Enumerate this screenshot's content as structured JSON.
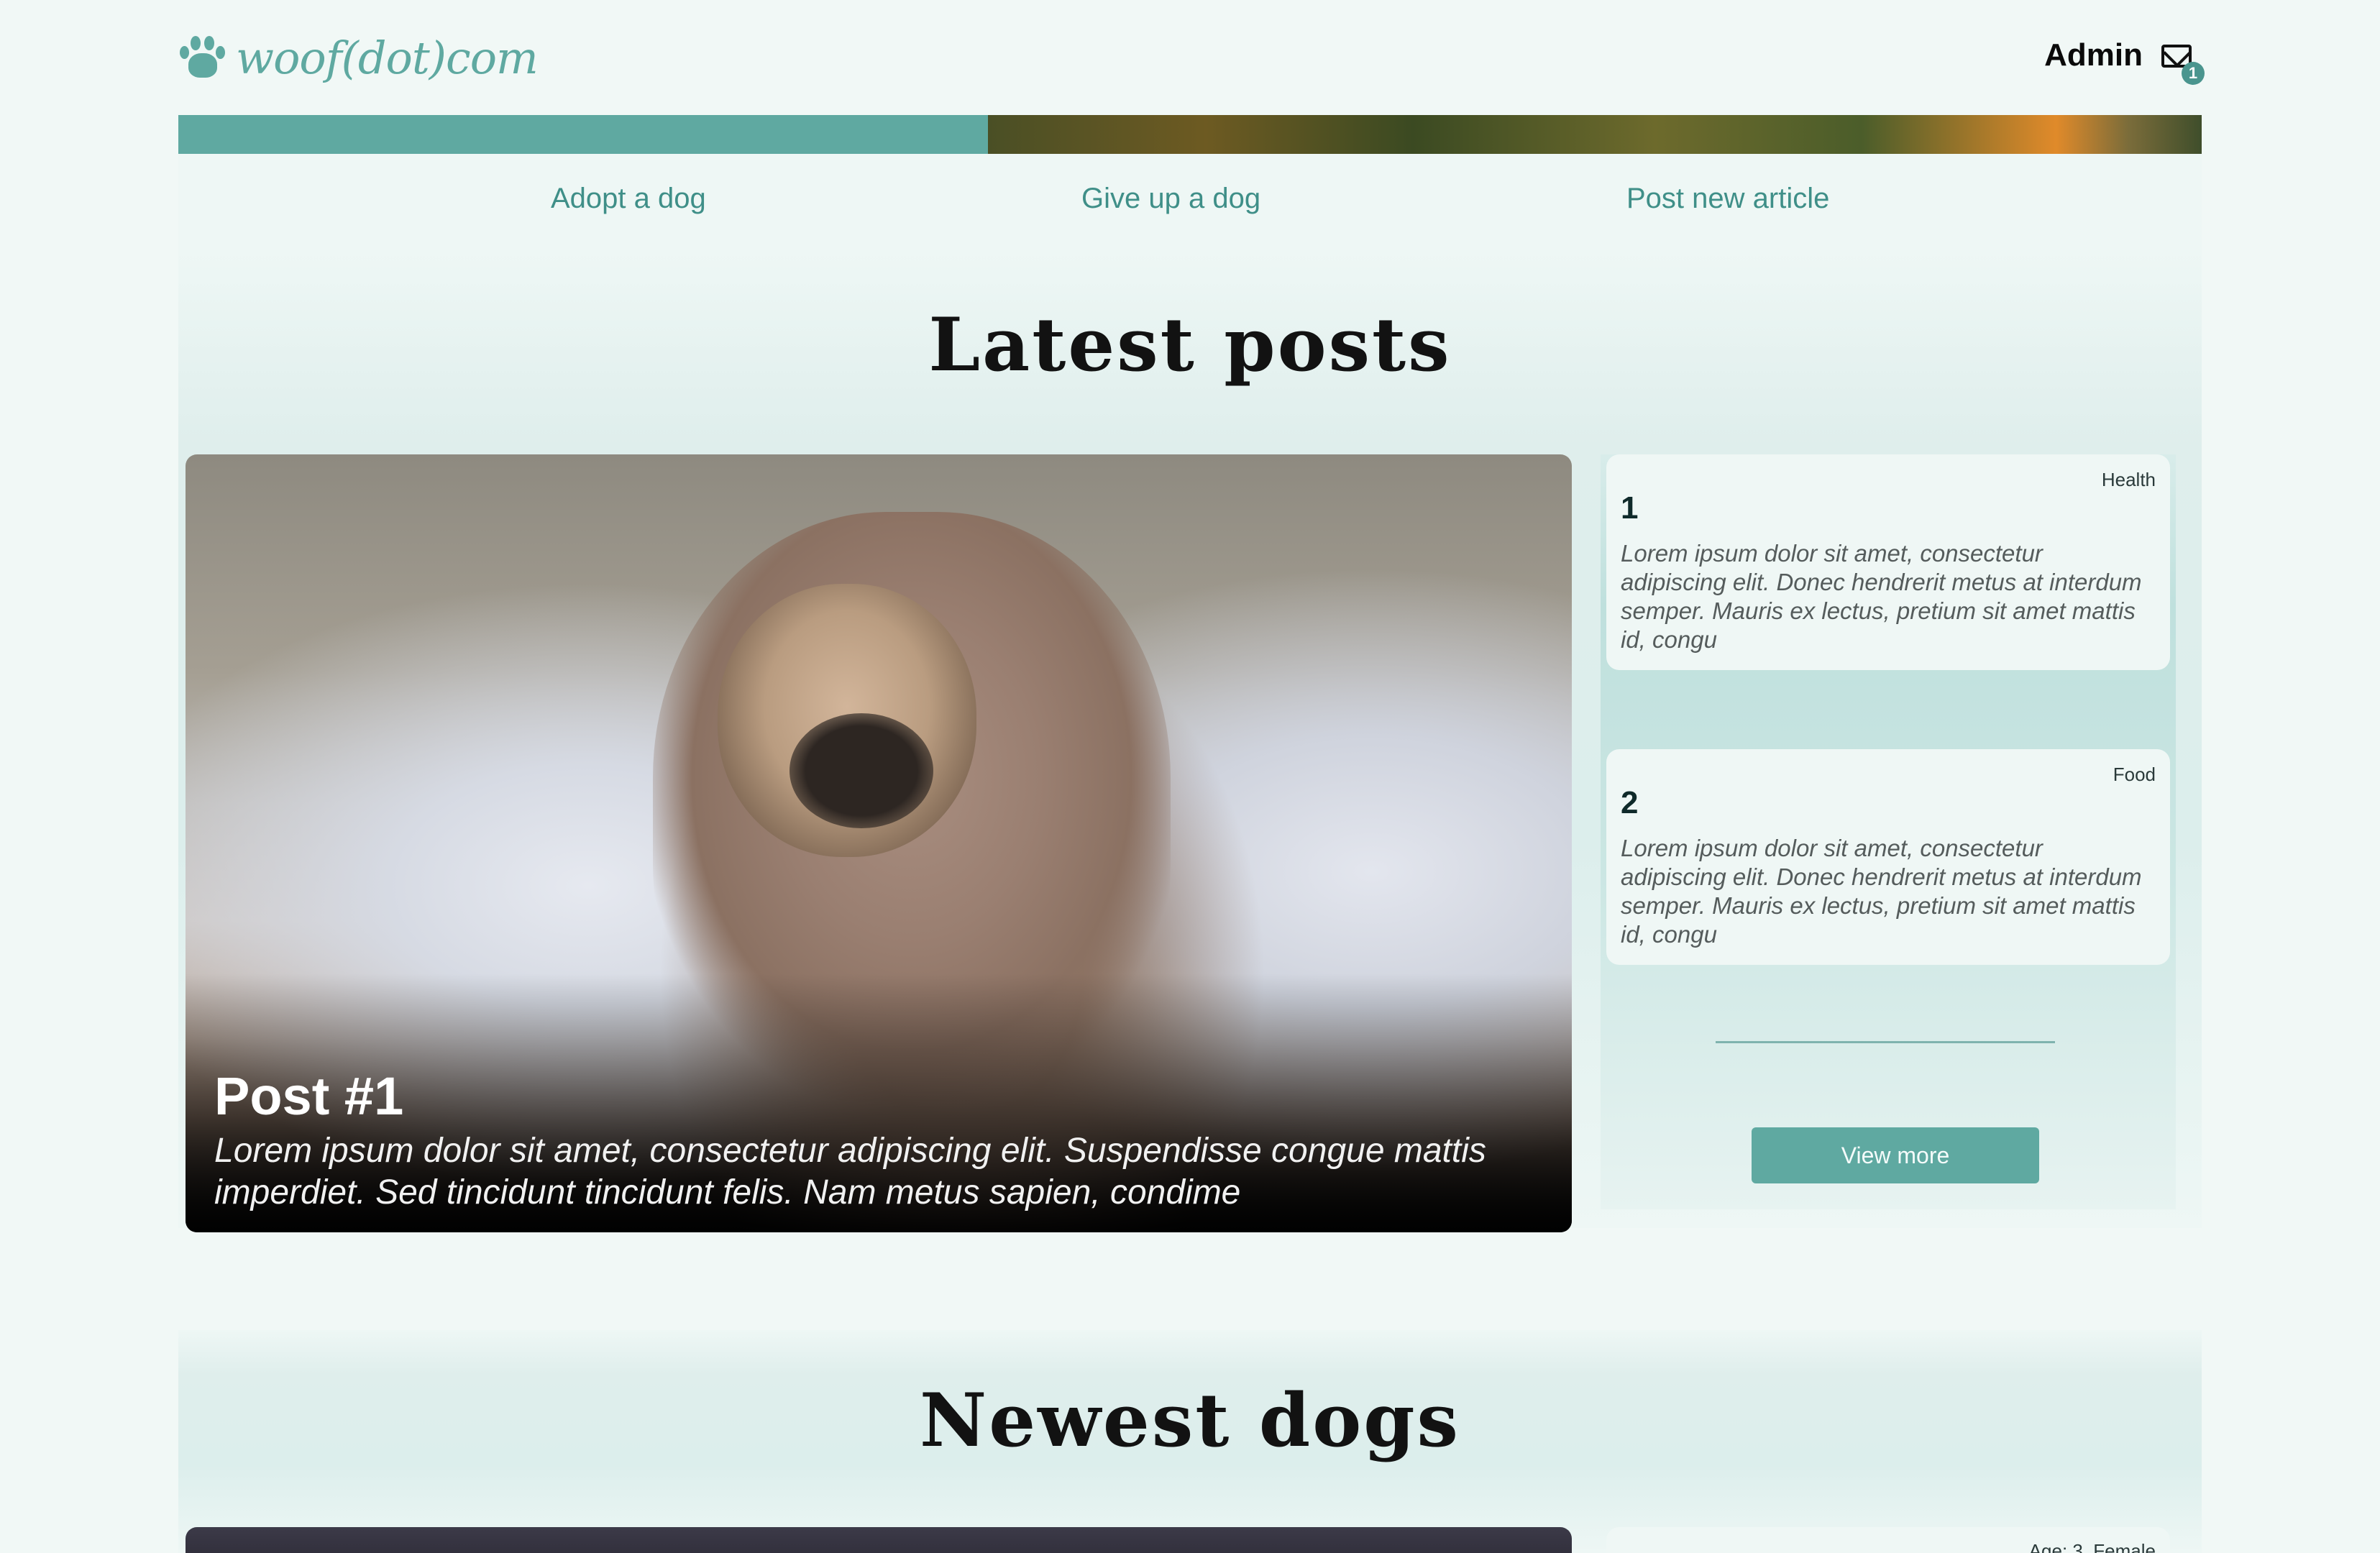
{
  "header": {
    "logo_text": "woof(dot)com",
    "user_name": "Admin",
    "mail_badge": "1"
  },
  "nav": {
    "items": [
      "Adopt a dog",
      "Give up a dog",
      "Post new article"
    ]
  },
  "latest_posts": {
    "title": "Latest posts",
    "featured": {
      "title": "Post #1",
      "excerpt": "Lorem ipsum dolor sit amet, consectetur adipiscing elit. Suspendisse congue mattis imperdiet. Sed tincidunt tincidunt felis. Nam metus sapien, condime"
    },
    "cards": [
      {
        "tag": "Health",
        "number": "1",
        "text": "Lorem ipsum dolor sit amet, consectetur adipiscing elit. Donec hendrerit metus at interdum semper. Mauris ex lectus, pretium sit amet mattis id, congu"
      },
      {
        "tag": "Food",
        "number": "2",
        "text": "Lorem ipsum dolor sit amet, consectetur adipiscing elit. Donec hendrerit metus at interdum semper. Mauris ex lectus, pretium sit amet mattis id, congu"
      }
    ],
    "view_more_label": "View more"
  },
  "newest_dogs": {
    "title": "Newest dogs",
    "first_card_tag": "Age: 3, Female"
  },
  "colors": {
    "accent": "#5fa9a1",
    "background": "#f1f8f6"
  }
}
